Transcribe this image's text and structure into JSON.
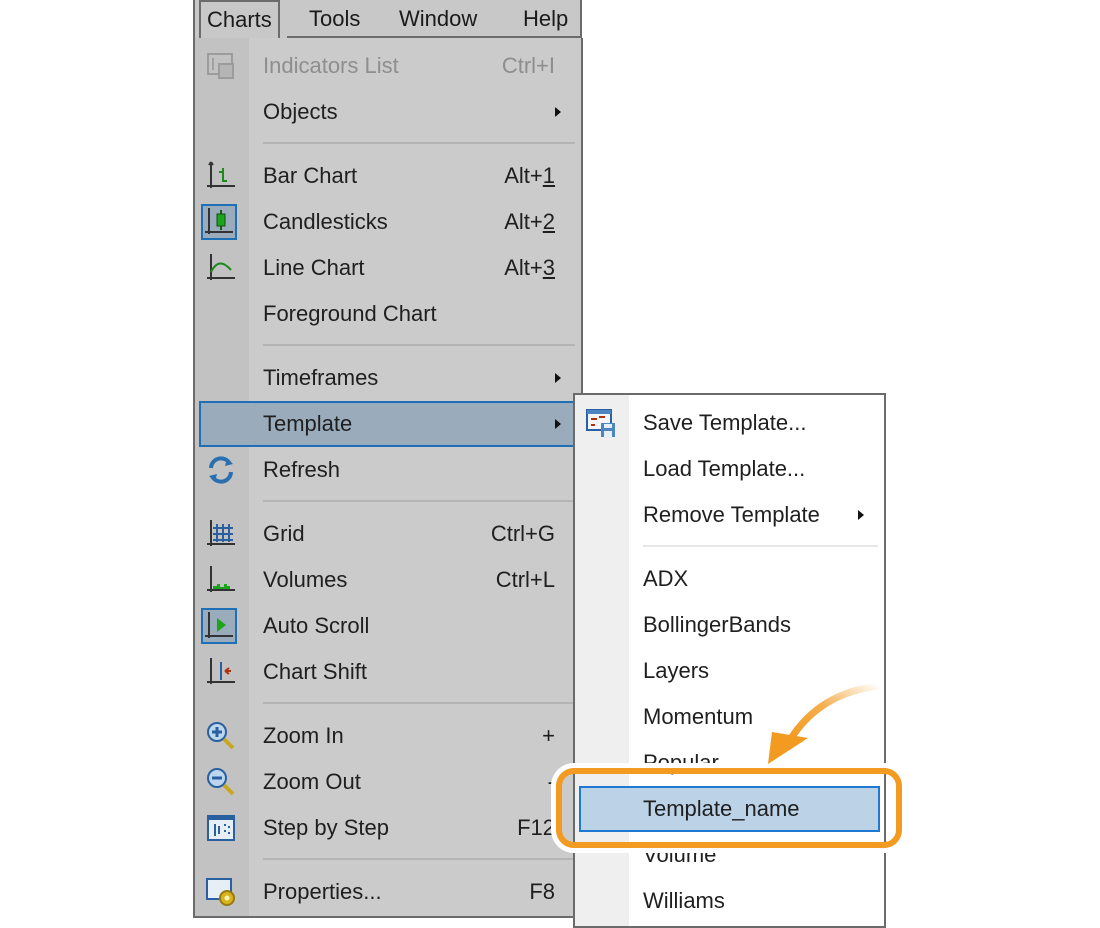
{
  "menubar": {
    "items": [
      "Charts",
      "Tools",
      "Window",
      "Help"
    ],
    "active": "Charts"
  },
  "charts_menu": {
    "items": [
      {
        "label": "Indicators List",
        "shortcut": "Ctrl+I",
        "icon": "indicators-list-icon",
        "disabled": true
      },
      {
        "label": "Objects",
        "submenu": true
      },
      {
        "label": "Bar Chart",
        "shortcut_prefix": "Alt+",
        "shortcut_key": "1",
        "icon": "bar-chart-icon"
      },
      {
        "label": "Candlesticks",
        "shortcut_prefix": "Alt+",
        "shortcut_key": "2",
        "icon": "candlesticks-icon",
        "checked": true
      },
      {
        "label": "Line Chart",
        "shortcut_prefix": "Alt+",
        "shortcut_key": "3",
        "icon": "line-chart-icon"
      },
      {
        "label": "Foreground Chart"
      },
      {
        "label": "Timeframes",
        "submenu": true
      },
      {
        "label": "Template",
        "submenu": true,
        "highlighted": true
      },
      {
        "label": "Refresh",
        "icon": "refresh-icon"
      },
      {
        "label": "Grid",
        "shortcut": "Ctrl+G",
        "icon": "grid-icon"
      },
      {
        "label": "Volumes",
        "shortcut": "Ctrl+L",
        "icon": "volumes-icon"
      },
      {
        "label": "Auto Scroll",
        "icon": "auto-scroll-icon",
        "checked": true
      },
      {
        "label": "Chart Shift",
        "icon": "chart-shift-icon"
      },
      {
        "label": "Zoom In",
        "shortcut": "+",
        "icon": "zoom-in-icon"
      },
      {
        "label": "Zoom Out",
        "shortcut": "-",
        "icon": "zoom-out-icon"
      },
      {
        "label": "Step by Step",
        "shortcut": "F12",
        "icon": "step-by-step-icon"
      },
      {
        "label": "Properties...",
        "shortcut": "F8",
        "icon": "properties-icon"
      }
    ]
  },
  "template_submenu": {
    "actions": [
      {
        "label": "Save Template...",
        "icon": "save-template-icon"
      },
      {
        "label": "Load Template..."
      },
      {
        "label": "Remove Template",
        "submenu": true
      }
    ],
    "templates": [
      "ADX",
      "BollingerBands",
      "Layers",
      "Momentum",
      "Popular",
      "Template_name",
      "Volume",
      "Williams"
    ],
    "selected": "Template_name"
  },
  "annotation": {
    "highlight_color": "#f39a21",
    "target": "Template_name"
  }
}
